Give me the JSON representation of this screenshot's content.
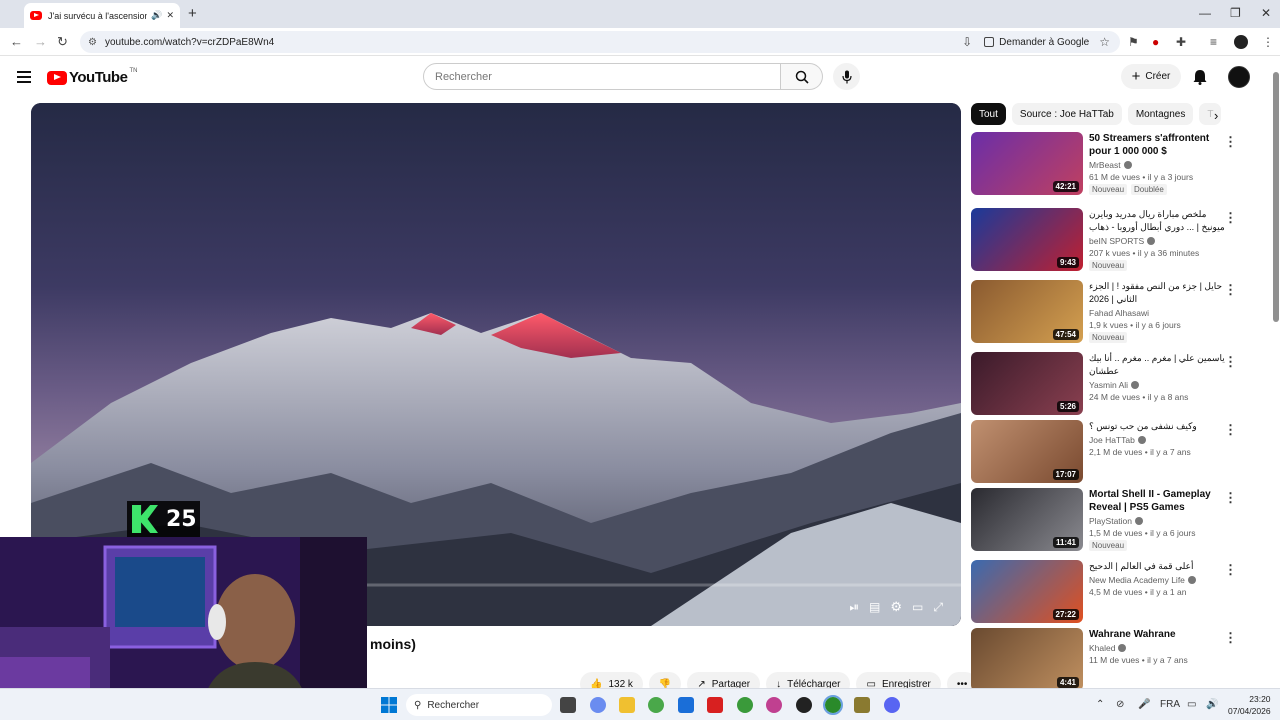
{
  "browser": {
    "tab_title": "J'ai survécu à l'ascension de",
    "tab_audio_icon": "speaker-icon",
    "url": "youtube.com/watch?v=crZDPaE8Wn4",
    "ask_google": "Demander à Google"
  },
  "header": {
    "logo_text": "YouTube",
    "country": "TN",
    "search_placeholder": "Rechercher",
    "create_label": "Créer"
  },
  "player": {
    "video_title_partial": "moins)",
    "overlay_badge": "25"
  },
  "actions": {
    "likes": "132 k",
    "share": "Partager",
    "download": "Télécharger",
    "save": "Enregistrer"
  },
  "chips": [
    "Tout",
    "Source : Joe HaTTab",
    "Montagnes",
    "T"
  ],
  "recommendations": [
    {
      "title": "50 Streamers s'affrontent pour 1 000 000 $",
      "channel": "MrBeast",
      "verified": true,
      "meta": "61 M de vues • il y a 3 jours",
      "duration": "42:21",
      "badges": [
        "Nouveau",
        "Doublée"
      ],
      "rtl": false
    },
    {
      "title": "ملخص مباراة ريال مدريد وبايرن ميونيخ | ... دوري أبطال أوروبا - ذهاب الدور ربع",
      "channel": "beIN SPORTS",
      "verified": true,
      "meta": "207 k vues • il y a 36 minutes",
      "duration": "9:43",
      "badges": [
        "Nouveau"
      ],
      "rtl": true
    },
    {
      "title": "حايل | جزء من النص مفقود ! | الجزء الثاني | 2026",
      "channel": "Fahad Alhasawi",
      "verified": false,
      "meta": "1,9 k vues • il y a 6 jours",
      "duration": "47:54",
      "badges": [
        "Nouveau"
      ],
      "rtl": true
    },
    {
      "title": "ياسمين علي | مغرم .. مغرم .. أنا بيك عطشان",
      "channel": "Yasmin Ali",
      "verified": true,
      "meta": "24 M de vues • il y a 8 ans",
      "duration": "5:26",
      "badges": [],
      "rtl": true
    },
    {
      "title": "وكيف نشفى من حب تونس ؟",
      "channel": "Joe HaTTab",
      "verified": true,
      "meta": "2,1 M de vues • il y a 7 ans",
      "duration": "17:07",
      "badges": [],
      "rtl": true
    },
    {
      "title": "Mortal Shell II - Gameplay Reveal | PS5 Games",
      "channel": "PlayStation",
      "verified": true,
      "meta": "1,5 M de vues • il y a 6 jours",
      "duration": "11:41",
      "badges": [
        "Nouveau"
      ],
      "rtl": false
    },
    {
      "title": "أعلى قمة في العالم | الدحيح",
      "channel": "New Media Academy Life",
      "verified": true,
      "meta": "4,5 M de vues • il y a 1 an",
      "duration": "27:22",
      "badges": [],
      "rtl": true
    },
    {
      "title": "Wahrane Wahrane",
      "channel": "Khaled",
      "verified": true,
      "meta": "11 M de vues • il y a 7 ans",
      "duration": "4:41",
      "badges": [],
      "rtl": false
    }
  ],
  "taskbar": {
    "search_label": "Rechercher",
    "lang": "FRA",
    "time": "23:20",
    "date": "07/04/2026"
  },
  "colors": {
    "yt_red": "#ff0000",
    "accent_green": "#3ee36b"
  }
}
